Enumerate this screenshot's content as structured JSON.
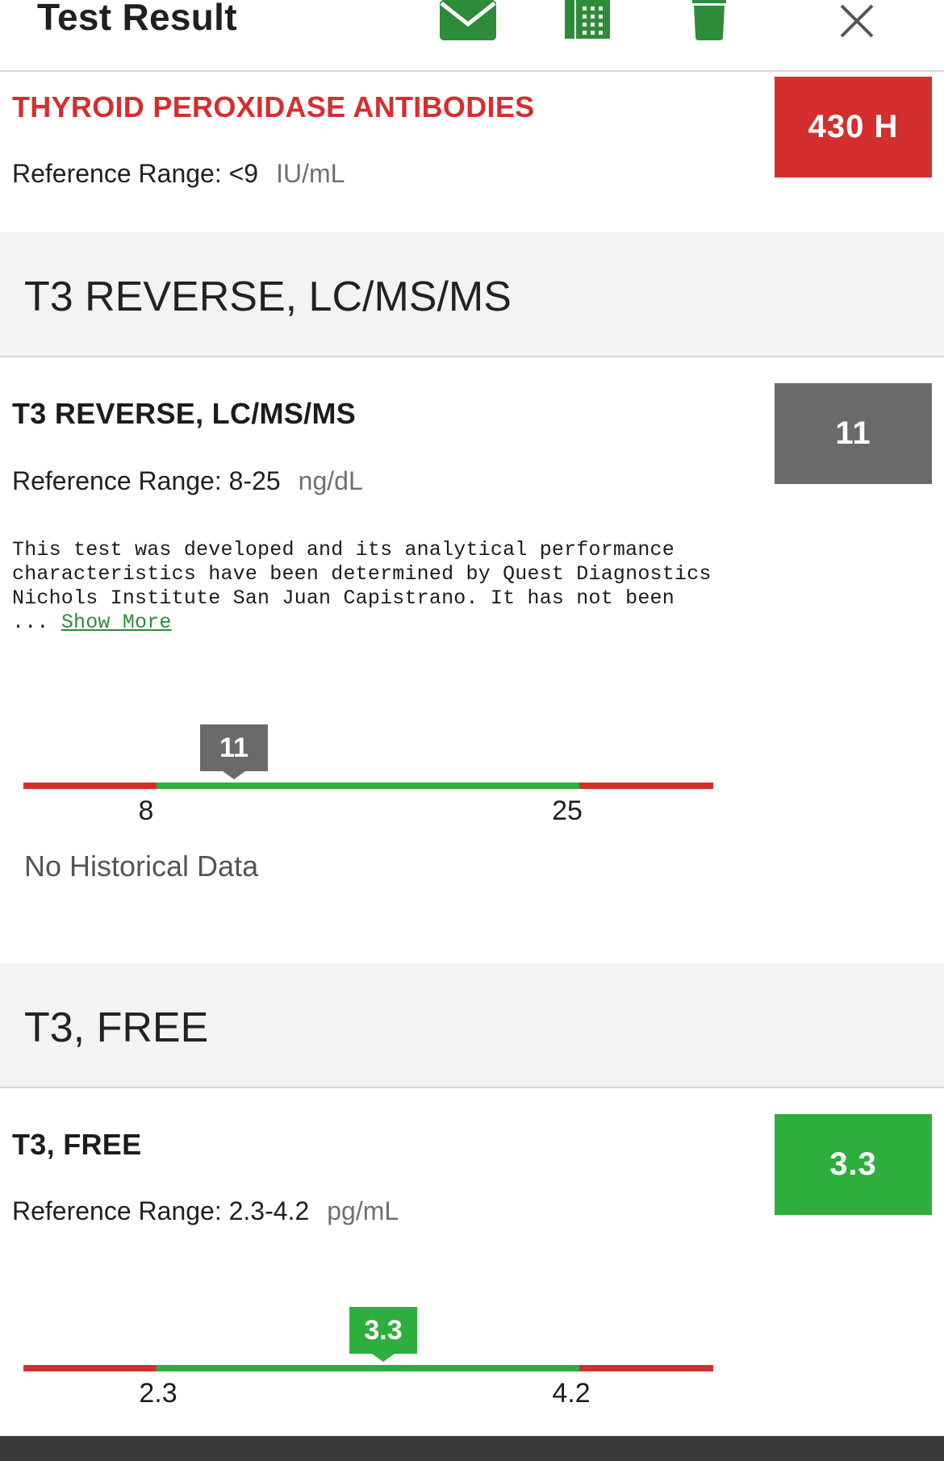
{
  "header": {
    "title": "Test Result",
    "icons": [
      "mail-icon",
      "fax-icon",
      "trash-icon",
      "close-icon"
    ]
  },
  "colors": {
    "accent_green": "#2e8b3a",
    "high_red": "#d32f2f",
    "normal_green": "#2eae3c",
    "neutral_gray": "#6a6a6a",
    "range_red": "#d32f2f"
  },
  "results": [
    {
      "name": "THYROID PEROXIDASE ANTIBODIES",
      "reference_label": "Reference Range: <9",
      "unit": "IU/mL",
      "value": "430 H",
      "flag": "high"
    },
    {
      "section_title": "T3 REVERSE, LC/MS/MS",
      "name": "T3 REVERSE, LC/MS/MS",
      "reference_label": "Reference Range: 8-25",
      "unit": "ng/dL",
      "value": "11",
      "flag": "normal",
      "note": "This test was developed and its analytical performance\ncharacteristics have been determined by Quest Diagnostics\nNichols Institute San Juan Capistrano. It has not been\n... ",
      "show_more": "Show More",
      "range": {
        "low_label": "8",
        "high_label": "25",
        "marker_label": "11"
      },
      "history": "No Historical Data"
    },
    {
      "section_title": "T3, FREE",
      "name": "T3, FREE",
      "reference_label": "Reference Range: 2.3-4.2",
      "unit": "pg/mL",
      "value": "3.3",
      "flag": "normal",
      "range": {
        "low_label": "2.3",
        "high_label": "4.2",
        "marker_label": "3.3"
      }
    }
  ]
}
